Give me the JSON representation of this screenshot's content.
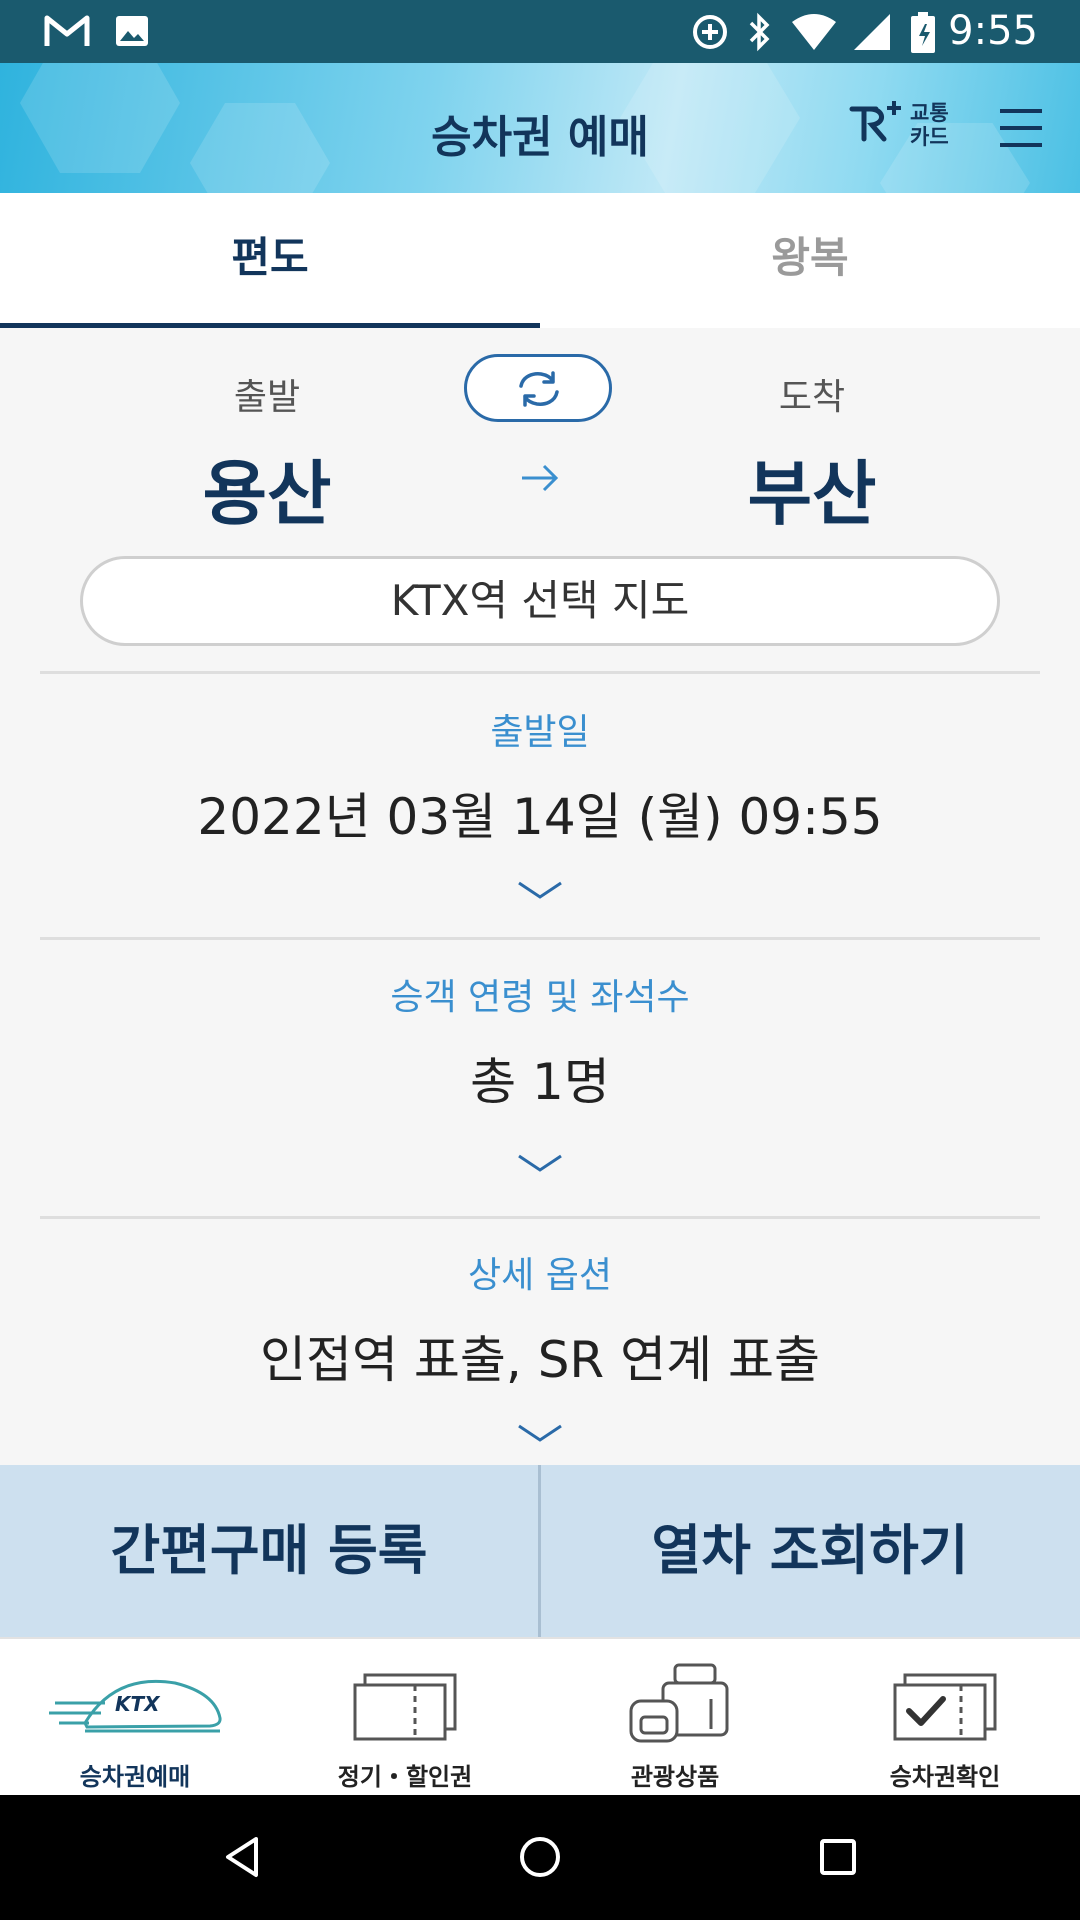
{
  "status_bar": {
    "time": "9:55",
    "icons": [
      "gmail-icon",
      "image-icon",
      "data-saver-icon",
      "bluetooth-icon",
      "wifi-icon",
      "signal-icon",
      "battery-icon"
    ]
  },
  "app_bar": {
    "title": "승차권 예매",
    "transit_card_line1": "교통",
    "transit_card_line2": "카드",
    "menu_icon": "hamburger-icon"
  },
  "tabs": [
    {
      "label": "편도",
      "active": true
    },
    {
      "label": "왕복",
      "active": false
    }
  ],
  "route": {
    "departure_label": "출발",
    "arrival_label": "도착",
    "departure_station": "용산",
    "arrival_station": "부산",
    "map_button": "KTX역 선택 지도"
  },
  "sections": {
    "date": {
      "label": "출발일",
      "value": "2022년 03월 14일 (월) 09:55"
    },
    "passengers": {
      "label": "승객 연령 및 좌석수",
      "value": "총 1명"
    },
    "options": {
      "label": "상세 옵션",
      "value": "인접역 표출, SR 연계 표출"
    }
  },
  "actions": {
    "quick_register": "간편구매 등록",
    "search_trains": "열차 조회하기"
  },
  "bottom_nav": [
    {
      "label": "승차권예매",
      "icon": "ktx-train-icon",
      "active": true
    },
    {
      "label": "정기・할인권",
      "icon": "ticket-icon",
      "active": false
    },
    {
      "label": "관광상품",
      "icon": "luggage-icon",
      "active": false
    },
    {
      "label": "승차권확인",
      "icon": "ticket-check-icon",
      "active": false
    }
  ],
  "colors": {
    "brand_navy": "#12355b",
    "accent_blue": "#3a8fcf",
    "action_bar": "#cde0ef",
    "status_bar": "#1a5a6e"
  }
}
